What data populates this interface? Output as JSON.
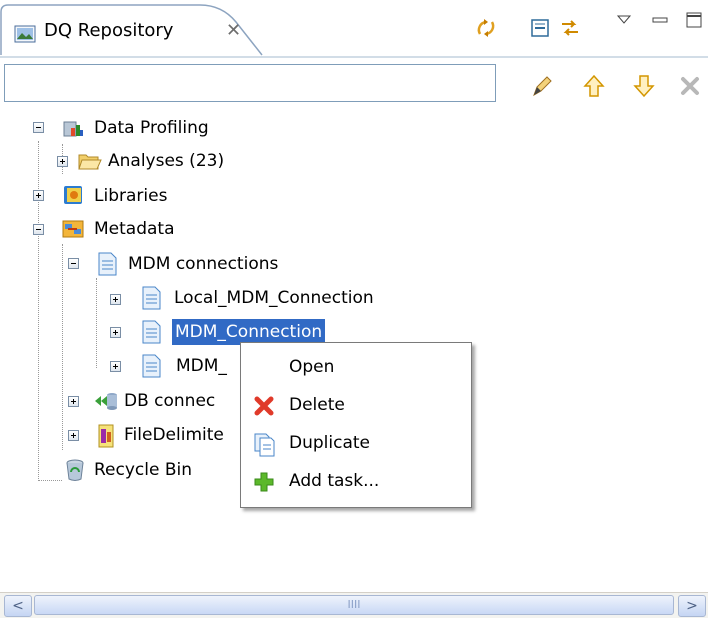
{
  "view": {
    "title": "DQ Repository",
    "close_glyph": "✕",
    "toolbar_icons": [
      "link-with-editor-icon",
      "collapse-all-icon",
      "sync-icon",
      "view-menu-icon",
      "minimize-icon",
      "maximize-icon"
    ]
  },
  "filter": {
    "value": "",
    "placeholder": "",
    "actions": [
      "edit-icon",
      "move-up-icon",
      "move-down-icon",
      "delete-icon"
    ]
  },
  "tree": {
    "data_profiling": "Data Profiling",
    "analyses": "Analyses (23)",
    "libraries": "Libraries",
    "metadata": "Metadata",
    "mdm_connections": "MDM connections",
    "local_mdm": "Local_MDM_Connection",
    "mdm_connection": "MDM_Connection",
    "mdm_third": "MDM_",
    "db_connections": "DB connec",
    "file_delimited": "FileDelimite",
    "recycle_bin": "Recycle Bin"
  },
  "context_menu": {
    "open": "Open",
    "delete": "Delete",
    "duplicate": "Duplicate",
    "add_task": "Add task..."
  },
  "scrollbar": {
    "left_arrow": "<",
    "right_arrow": ">",
    "grip": "IIII"
  },
  "colors": {
    "selection": "#316ac5",
    "border": "#7f9db9"
  }
}
